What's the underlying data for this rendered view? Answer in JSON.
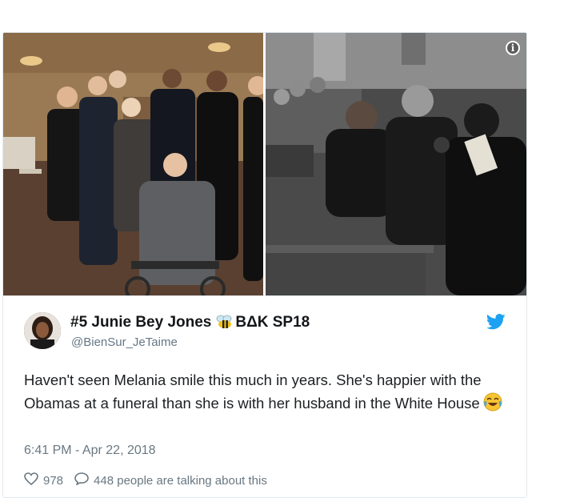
{
  "tweet": {
    "author_name": "#5 Junie Bey Jones",
    "author_suffix": "BΔK SP18",
    "handle": "@BienSur_JeTaime",
    "text": "Haven't seen Melania smile this much in years. She's happier with the Obamas at a funeral than she is with her husband in the White House",
    "emoji": "face-with-tears-of-joy",
    "timestamp": "6:41 PM - Apr 22, 2018",
    "likes": "978",
    "talking": "448 people are talking about this"
  },
  "media": {
    "info_label": "i"
  },
  "icons": {
    "bee": "bee-icon",
    "bird": "twitter-bird-icon",
    "heart": "heart-icon",
    "reply": "speech-bubble-icon",
    "info": "info-icon"
  },
  "colors": {
    "twitter_blue": "#1da1f2",
    "text": "#1c2022",
    "muted": "#697882"
  }
}
